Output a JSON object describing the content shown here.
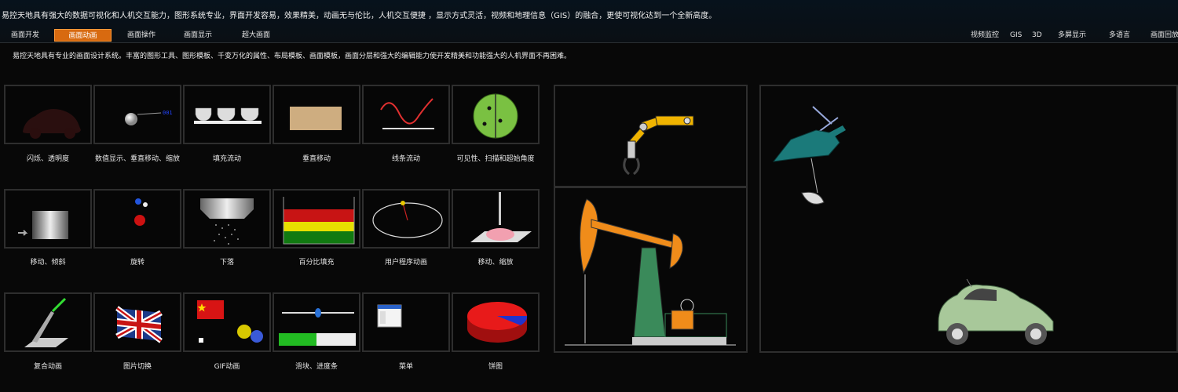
{
  "header": {
    "intro_text": "易控天地具有强大的数据可视化和人机交互能力，图形系统专业，界面开发容易，效果精美，动画无与伦比，人机交互便捷 ，显示方式灵活，视频和地理信息（GIS）的融合，更使可视化达到一个全新高度。",
    "tabs_left": [
      {
        "label": "画面开发"
      },
      {
        "label": "画面动画"
      },
      {
        "label": "画面操作"
      },
      {
        "label": "画面显示"
      },
      {
        "label": "超大画面"
      }
    ],
    "active_tab": "画面动画",
    "tabs_right": [
      {
        "label": "视频监控"
      },
      {
        "label": "GIS"
      },
      {
        "label": "3D"
      },
      {
        "label": "多屏显示"
      },
      {
        "label": "多语言"
      },
      {
        "label": "画面回放"
      }
    ]
  },
  "description": "易控天地具有专业的画面设计系统。丰富的图形工具、图形模板、千变万化的属性、布局模板、画面模板，画面分层和强大的编辑能力使开发精美和功能强大的人机界面不再困难。",
  "demos": [
    {
      "label": "闪烁、透明度",
      "icon": "car-faded-icon"
    },
    {
      "label": "数值显示、垂直移动、缩放",
      "icon": "ball-value-icon",
      "value_text": "001"
    },
    {
      "label": "填充流动",
      "icon": "teacups-icon"
    },
    {
      "label": "垂直移动",
      "icon": "texture-icon"
    },
    {
      "label": "线条流动",
      "icon": "wave-line-icon"
    },
    {
      "label": "可见性、扫描和超始角度",
      "icon": "radar-icon"
    },
    {
      "label": "移动、倾斜",
      "icon": "cylinder-icon"
    },
    {
      "label": "旋转",
      "icon": "rotating-balls-icon"
    },
    {
      "label": "下落",
      "icon": "funnel-icon"
    },
    {
      "label": "百分比填充",
      "icon": "tank-fill-icon"
    },
    {
      "label": "用户程序动画",
      "icon": "pendulum-icon"
    },
    {
      "label": "移动、缩放",
      "icon": "plunger-icon"
    },
    {
      "label": "复合动画",
      "icon": "laser-icon"
    },
    {
      "label": "图片切换",
      "icon": "uk-flag-icon"
    },
    {
      "label": "GIF动画",
      "icon": "gears-flag-icon"
    },
    {
      "label": "滑块、进度条",
      "icon": "slider-progress-icon"
    },
    {
      "label": "菜单",
      "icon": "menu-icon"
    },
    {
      "label": "饼图",
      "icon": "pie-3d-icon"
    }
  ],
  "panels": {
    "robot_arm": "robot-arm-icon",
    "pumpjack": "oil-pumpjack-icon",
    "helicopter": "helicopter-icon",
    "car": "green-car-icon"
  },
  "colors": {
    "accent": "#d86a10",
    "background": "#080808",
    "cell_border": "#2e2e2e"
  }
}
